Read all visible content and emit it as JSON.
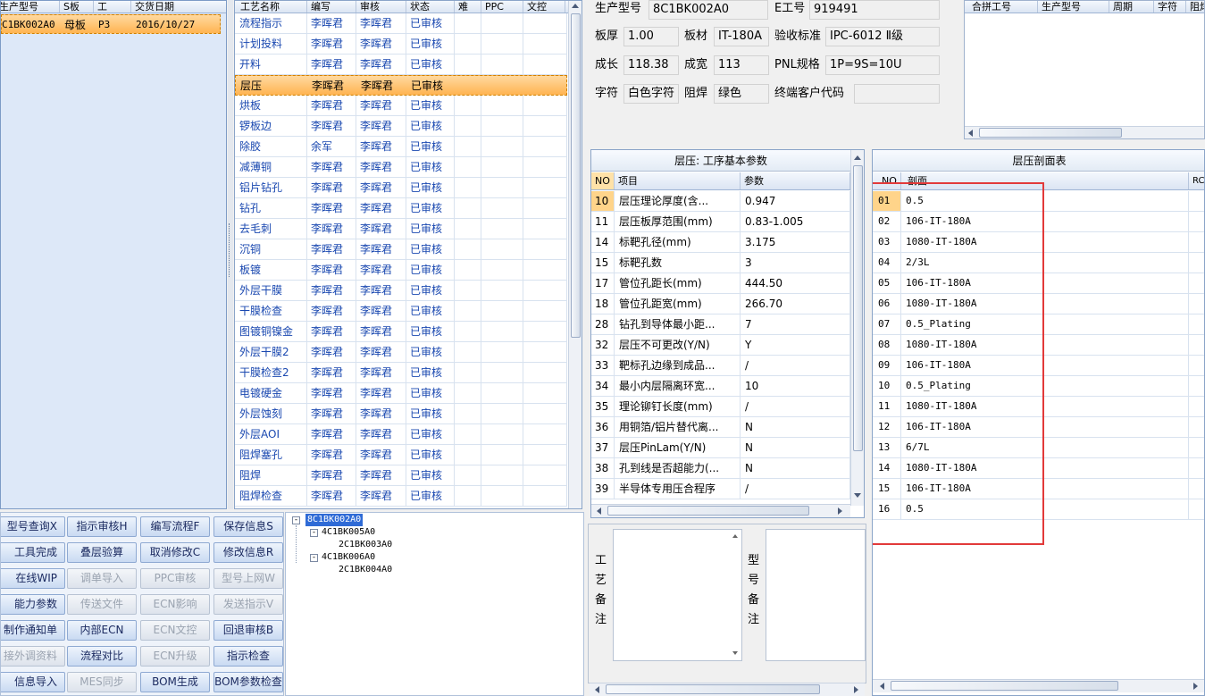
{
  "order_table": {
    "headers": [
      "生产型号",
      "S板",
      "工",
      "交货日期"
    ],
    "rows": [
      [
        "C1BK002A0",
        "母板",
        "P3",
        "2016/10/27"
      ]
    ]
  },
  "process_table": {
    "headers": [
      "工艺名称",
      "编写",
      "审核",
      "状态",
      "难",
      "PPC",
      "文控"
    ],
    "rows": [
      [
        "流程指示",
        "李晖君",
        "李晖君",
        "已审核"
      ],
      [
        "计划投料",
        "李晖君",
        "李晖君",
        "已审核"
      ],
      [
        "开料",
        "李晖君",
        "李晖君",
        "已审核"
      ],
      [
        "层压",
        "李晖君",
        "李晖君",
        "已审核"
      ],
      [
        "烘板",
        "李晖君",
        "李晖君",
        "已审核"
      ],
      [
        "锣板边",
        "李晖君",
        "李晖君",
        "已审核"
      ],
      [
        "除胶",
        "余军",
        "李晖君",
        "已审核"
      ],
      [
        "减薄铜",
        "李晖君",
        "李晖君",
        "已审核"
      ],
      [
        "铝片钻孔",
        "李晖君",
        "李晖君",
        "已审核"
      ],
      [
        "钻孔",
        "李晖君",
        "李晖君",
        "已审核"
      ],
      [
        "去毛刺",
        "李晖君",
        "李晖君",
        "已审核"
      ],
      [
        "沉铜",
        "李晖君",
        "李晖君",
        "已审核"
      ],
      [
        "板镀",
        "李晖君",
        "李晖君",
        "已审核"
      ],
      [
        "外层干膜",
        "李晖君",
        "李晖君",
        "已审核"
      ],
      [
        "干膜检查",
        "李晖君",
        "李晖君",
        "已审核"
      ],
      [
        "图镀铜镍金",
        "李晖君",
        "李晖君",
        "已审核"
      ],
      [
        "外层干膜2",
        "李晖君",
        "李晖君",
        "已审核"
      ],
      [
        "干膜检查2",
        "李晖君",
        "李晖君",
        "已审核"
      ],
      [
        "电镀硬金",
        "李晖君",
        "李晖君",
        "已审核"
      ],
      [
        "外层蚀刻",
        "李晖君",
        "李晖君",
        "已审核"
      ],
      [
        "外层AOI",
        "李晖君",
        "李晖君",
        "已审核"
      ],
      [
        "阻焊塞孔",
        "李晖君",
        "李晖君",
        "已审核"
      ],
      [
        "阻焊",
        "李晖君",
        "李晖君",
        "已审核"
      ],
      [
        "阻焊检查",
        "李晖君",
        "李晖君",
        "已审核"
      ]
    ]
  },
  "info": {
    "model_label": "生产型号",
    "model_value": "8C1BK002A0",
    "eno_label": "E工号",
    "eno_value": "919491",
    "thick_label": "板厚",
    "thick_value": "1.00",
    "mat_label": "板材",
    "mat_value": "IT-180A",
    "std_label": "验收标准",
    "std_value": "IPC-6012 Ⅱ级",
    "len_label": "成长",
    "len_value": "118.38",
    "wid_label": "成宽",
    "wid_value": "113",
    "pnl_label": "PNL规格",
    "pnl_value": "1P=9S=10U",
    "char_label": "字符",
    "char_value": "白色字符",
    "mask_label": "阻焊",
    "mask_value": "绿色",
    "cust_label": "终端客户代码",
    "cust_value": ""
  },
  "merge_table": {
    "headers": [
      "合拼工号",
      "生产型号",
      "周期",
      "字符",
      "阻焊"
    ]
  },
  "params": {
    "title": "层压: 工序基本参数",
    "headers": [
      "NO",
      "项目",
      "参数"
    ],
    "rows": [
      [
        "10",
        "层压理论厚度(含...",
        "0.947"
      ],
      [
        "11",
        "层压板厚范围(mm)",
        "0.83-1.005"
      ],
      [
        "14",
        "标靶孔径(mm)",
        "3.175"
      ],
      [
        "15",
        "标靶孔数",
        "3"
      ],
      [
        "17",
        "管位孔距长(mm)",
        "444.50"
      ],
      [
        "18",
        "管位孔距宽(mm)",
        "266.70"
      ],
      [
        "28",
        "钻孔到导体最小距...",
        "7"
      ],
      [
        "32",
        "层压不可更改(Y/N)",
        "Y"
      ],
      [
        "33",
        "靶标孔边缘到成品...",
        "/"
      ],
      [
        "34",
        "最小内层隔离环宽...",
        "10"
      ],
      [
        "35",
        "理论铆钉长度(mm)",
        "/"
      ],
      [
        "36",
        "用铜箔/铝片替代离...",
        "N"
      ],
      [
        "37",
        "层压PinLam(Y/N)",
        "N"
      ],
      [
        "38",
        "孔到线是否超能力(...",
        "N"
      ],
      [
        "39",
        "半导体专用压合程序",
        "/"
      ]
    ]
  },
  "stackup": {
    "title": "层压剖面表",
    "headers": [
      "NO",
      "剖面",
      "RC%"
    ],
    "rows": [
      [
        "01",
        "0.5"
      ],
      [
        "02",
        "106-IT-180A"
      ],
      [
        "03",
        "1080-IT-180A"
      ],
      [
        "04",
        "2/3L"
      ],
      [
        "05",
        "106-IT-180A"
      ],
      [
        "06",
        "1080-IT-180A"
      ],
      [
        "07",
        "0.5_Plating"
      ],
      [
        "08",
        "1080-IT-180A"
      ],
      [
        "09",
        "106-IT-180A"
      ],
      [
        "10",
        "0.5_Plating"
      ],
      [
        "11",
        "1080-IT-180A"
      ],
      [
        "12",
        "106-IT-180A"
      ],
      [
        "13",
        "6/7L"
      ],
      [
        "14",
        "1080-IT-180A"
      ],
      [
        "15",
        "106-IT-180A"
      ],
      [
        "16",
        "0.5"
      ]
    ]
  },
  "buttons": [
    [
      {
        "label": "型号查询X",
        "enabled": true
      },
      {
        "label": "指示审核H",
        "enabled": true
      },
      {
        "label": "编写流程F",
        "enabled": true
      },
      {
        "label": "保存信息S",
        "enabled": true
      }
    ],
    [
      {
        "label": "工具完成",
        "enabled": true
      },
      {
        "label": "叠层验算",
        "enabled": true
      },
      {
        "label": "取消修改C",
        "enabled": true
      },
      {
        "label": "修改信息R",
        "enabled": true
      }
    ],
    [
      {
        "label": "在线WIP",
        "enabled": true
      },
      {
        "label": "调单导入",
        "enabled": false
      },
      {
        "label": "PPC审核",
        "enabled": false
      },
      {
        "label": "型号上网W",
        "enabled": false
      }
    ],
    [
      {
        "label": "能力参数",
        "enabled": true
      },
      {
        "label": "传送文件",
        "enabled": false
      },
      {
        "label": "ECN影响",
        "enabled": false
      },
      {
        "label": "发送指示V",
        "enabled": false
      }
    ],
    [
      {
        "label": "制作通知单",
        "enabled": true
      },
      {
        "label": "内部ECN",
        "enabled": true
      },
      {
        "label": "ECN文控",
        "enabled": false
      },
      {
        "label": "回退审核B",
        "enabled": true
      }
    ],
    [
      {
        "label": "接外调资料",
        "enabled": false
      },
      {
        "label": "流程对比",
        "enabled": true
      },
      {
        "label": "ECN升级",
        "enabled": false
      },
      {
        "label": "指示检查",
        "enabled": true
      }
    ],
    [
      {
        "label": "信息导入",
        "enabled": true
      },
      {
        "label": "MES同步",
        "enabled": false
      },
      {
        "label": "BOM生成",
        "enabled": true
      },
      {
        "label": "BOM参数检查",
        "enabled": true
      }
    ]
  ],
  "tree": {
    "root": "8C1BK002A0",
    "children": [
      {
        "label": "4C1BK005A0",
        "child": "2C1BK003A0"
      },
      {
        "label": "4C1BK006A0",
        "child": "2C1BK004A0"
      }
    ]
  },
  "notes": {
    "process_label": "工艺备注",
    "model_label": "型号备注"
  }
}
